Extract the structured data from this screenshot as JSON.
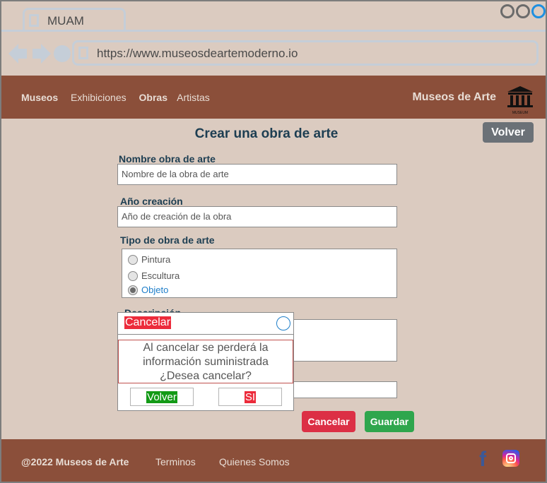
{
  "browser": {
    "tab_title": "MUAM",
    "url": "https://www.museosdeartemoderno.io"
  },
  "header": {
    "nav": [
      "Museos",
      "Exhibiciones",
      "Obras",
      "Artistas"
    ],
    "brand": "Museos de Arte",
    "logo_text": "MUSEUM"
  },
  "page": {
    "title": "Crear una obra de arte",
    "back_button": "Volver"
  },
  "form": {
    "name_label": "Nombre obra de arte",
    "name_placeholder": "Nombre de la obra de arte",
    "year_label": "Año creación",
    "year_placeholder": "Año de creación de la obra",
    "type_label": "Tipo de obra de arte",
    "type_options": [
      "Pintura",
      "Escultura",
      "Objeto"
    ],
    "selected_type": "Objeto",
    "description_label": "Descripción",
    "cancel_button": "Cancelar",
    "save_button": "Guardar"
  },
  "modal": {
    "title": "Cancelar",
    "message_line1": "Al cancelar se perderá la",
    "message_line2": "información suministrada",
    "message_line3": "¿Desea cancelar?",
    "back_button": "Volver",
    "yes_button": "SI"
  },
  "footer": {
    "copyright": "@2022 Museos de Arte",
    "terms": "Terminos",
    "about": "Quienes Somos"
  },
  "colors": {
    "background": "#dbcbc0",
    "header": "#8b4f3a",
    "danger": "#dc2f45",
    "success": "#2fa64d",
    "title": "#1d3e52"
  }
}
